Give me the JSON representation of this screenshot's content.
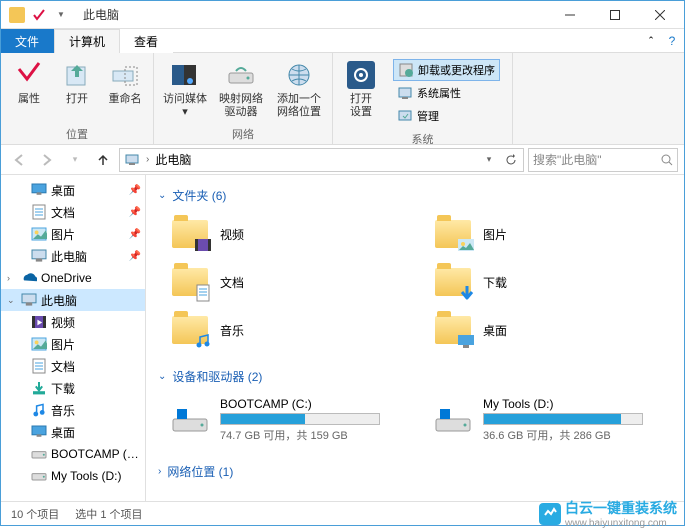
{
  "title": "此电脑",
  "tabs": {
    "file": "文件",
    "computer": "计算机",
    "view": "查看"
  },
  "ribbon": {
    "properties": "属性",
    "open": "打开",
    "rename": "重命名",
    "access_media": "访问媒体",
    "map_drive": "映射网络\n驱动器",
    "add_loc": "添加一个\n网络位置",
    "open_settings": "打开\n设置",
    "uninstall": "卸载或更改程序",
    "sysprops": "系统属性",
    "manage": "管理",
    "g_location": "位置",
    "g_network": "网络",
    "g_system": "系统"
  },
  "address": {
    "label": "此电脑"
  },
  "search": {
    "placeholder": "搜索\"此电脑\""
  },
  "sidebar": {
    "items": [
      {
        "label": "桌面",
        "icon": "desktop",
        "pin": true,
        "lvl": 1
      },
      {
        "label": "文档",
        "icon": "doc",
        "pin": true,
        "lvl": 1
      },
      {
        "label": "图片",
        "icon": "pic",
        "pin": true,
        "lvl": 1
      },
      {
        "label": "此电脑",
        "icon": "pc",
        "pin": true,
        "lvl": 1
      },
      {
        "label": "OneDrive",
        "icon": "onedrive",
        "lvl": 0,
        "exp": true
      },
      {
        "label": "此电脑",
        "icon": "pc",
        "lvl": 0,
        "sel": true,
        "exp": true
      },
      {
        "label": "视频",
        "icon": "video",
        "lvl": 1
      },
      {
        "label": "图片",
        "icon": "pic",
        "lvl": 1
      },
      {
        "label": "文档",
        "icon": "doc",
        "lvl": 1
      },
      {
        "label": "下载",
        "icon": "dl",
        "lvl": 1
      },
      {
        "label": "音乐",
        "icon": "music",
        "lvl": 1
      },
      {
        "label": "桌面",
        "icon": "desktop",
        "lvl": 1
      },
      {
        "label": "BOOTCAMP (C:)",
        "icon": "drive",
        "lvl": 1
      },
      {
        "label": "My Tools (D:)",
        "icon": "drive",
        "lvl": 1
      }
    ]
  },
  "sections": {
    "folders": {
      "title": "文件夹 (6)"
    },
    "devices": {
      "title": "设备和驱动器 (2)"
    },
    "network": {
      "title": "网络位置 (1)"
    }
  },
  "folders": [
    {
      "name": "视频",
      "icon": "video"
    },
    {
      "name": "图片",
      "icon": "pic"
    },
    {
      "name": "文档",
      "icon": "doc"
    },
    {
      "name": "下载",
      "icon": "dl"
    },
    {
      "name": "音乐",
      "icon": "music"
    },
    {
      "name": "桌面",
      "icon": "desktop"
    }
  ],
  "drives": [
    {
      "name": "BOOTCAMP (C:)",
      "free": "74.7 GB 可用，共 159 GB",
      "fill": 53
    },
    {
      "name": "My Tools (D:)",
      "free": "36.6 GB 可用，共 286 GB",
      "fill": 87
    }
  ],
  "status": {
    "count": "10 个项目",
    "selected": "选中 1 个项目"
  },
  "watermark": {
    "text": "白云一键重装系统",
    "url": "www.baiyunxitong.com"
  }
}
